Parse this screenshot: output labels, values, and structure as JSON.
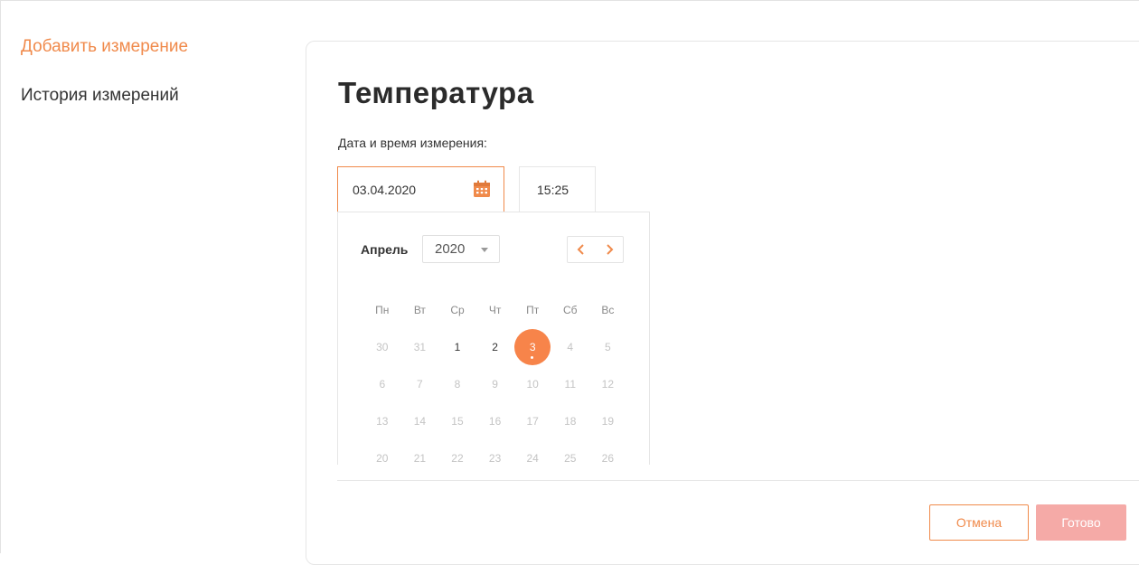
{
  "sidebar": {
    "items": [
      {
        "label": "Добавить измерение",
        "active": true
      },
      {
        "label": "История измерений",
        "active": false
      }
    ]
  },
  "form": {
    "title": "Температура",
    "datetime_label": "Дата и время измерения:",
    "date_value": "03.04.2020",
    "time_value": "15:25"
  },
  "datepicker": {
    "month": "Апрель",
    "year": "2020",
    "weekdays": [
      "Пн",
      "Вт",
      "Ср",
      "Чт",
      "Пт",
      "Сб",
      "Вс"
    ],
    "weeks": [
      [
        "30",
        "31",
        "1",
        "2",
        "3",
        "4",
        "5"
      ],
      [
        "6",
        "7",
        "8",
        "9",
        "10",
        "11",
        "12"
      ],
      [
        "13",
        "14",
        "15",
        "16",
        "17",
        "18",
        "19"
      ],
      [
        "20",
        "21",
        "22",
        "23",
        "24",
        "25",
        "26"
      ]
    ],
    "selected_day": "3",
    "enabled_days": [
      "1",
      "2",
      "3"
    ]
  },
  "actions": {
    "cancel_label": "Отмена",
    "done_label": "Готово"
  },
  "colors": {
    "accent": "#f08a4b",
    "selected_day": "#f7844a",
    "done_disabled": "#f5aaa7"
  },
  "icons": {
    "date_field": "calendar-icon",
    "prev": "chevron-left-icon",
    "next": "chevron-right-icon",
    "year_dropdown": "caret-down-icon"
  }
}
